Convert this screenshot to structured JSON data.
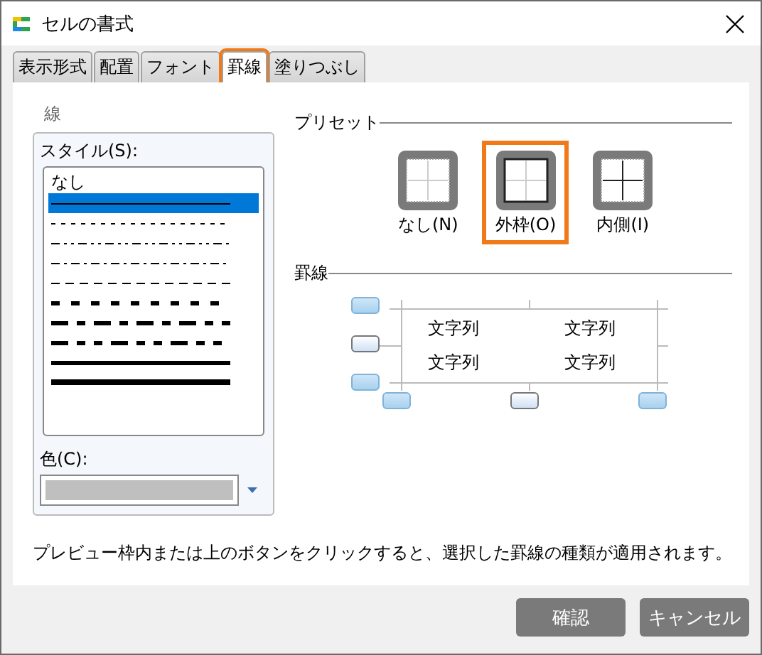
{
  "window": {
    "title": "セルの書式"
  },
  "tabs": [
    {
      "label": "表示形式",
      "selected": false
    },
    {
      "label": "配置",
      "selected": false
    },
    {
      "label": "フォント",
      "selected": false
    },
    {
      "label": "罫線",
      "selected": true
    },
    {
      "label": "塗りつぶし",
      "selected": false
    }
  ],
  "line_group": {
    "title": "線",
    "style_label": "スタイル(S):",
    "styles": [
      {
        "kind": "none",
        "label": "なし",
        "selected": false
      },
      {
        "kind": "thin",
        "selected": true
      },
      {
        "kind": "dotted",
        "selected": false
      },
      {
        "kind": "dash-dot-dot",
        "selected": false
      },
      {
        "kind": "dash-dot",
        "selected": false
      },
      {
        "kind": "dashed",
        "selected": false
      },
      {
        "kind": "medium-dashed",
        "selected": false
      },
      {
        "kind": "medium-dash-dot",
        "selected": false
      },
      {
        "kind": "medium-dash-dot-dot",
        "selected": false
      },
      {
        "kind": "medium",
        "selected": false
      },
      {
        "kind": "thick",
        "selected": false
      }
    ],
    "color_label": "色(C):"
  },
  "presets": {
    "title": "プリセット",
    "items": [
      {
        "kind": "none",
        "label": "なし(N)",
        "selected": false
      },
      {
        "kind": "outline",
        "label": "外枠(O)",
        "selected": true
      },
      {
        "kind": "inside",
        "label": "内側(I)",
        "selected": false
      }
    ]
  },
  "border": {
    "title": "罫線",
    "toggles": [
      {
        "kind": "top",
        "on": true
      },
      {
        "kind": "middle-horizontal",
        "on": false
      },
      {
        "kind": "bottom",
        "on": true
      },
      {
        "kind": "left",
        "on": true
      },
      {
        "kind": "middle-vertical",
        "on": false
      },
      {
        "kind": "right",
        "on": true
      }
    ],
    "cells": [
      "文字列",
      "文字列",
      "文字列",
      "文字列"
    ]
  },
  "hint": "プレビュー枠内または上のボタンをクリックすると、選択した罫線の種類が適用されます。",
  "buttons": [
    "確認",
    "キャンセル"
  ]
}
